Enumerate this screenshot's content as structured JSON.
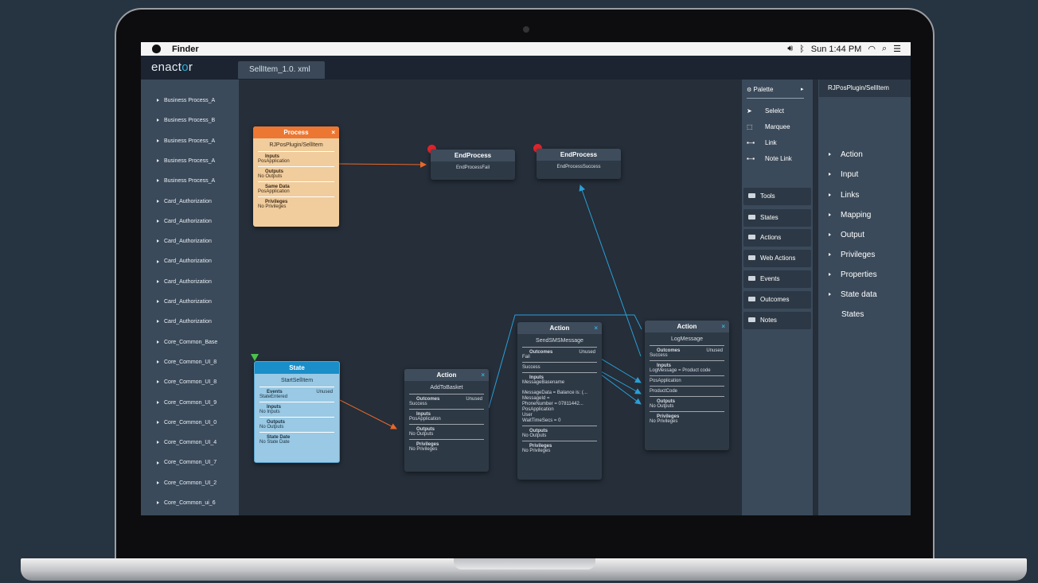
{
  "menubar": {
    "app": "Finder",
    "status": "Sun 1:44 PM"
  },
  "app": {
    "logo_pre": "enact",
    "logo_o": "o",
    "logo_post": "r",
    "tab": "SellItem_1.0. xml"
  },
  "sidebar": {
    "items": [
      "Business Process_A",
      "Business Process_B",
      "Business Process_A",
      "Business Process_A",
      "Business Process_A",
      "Card_Authorization",
      "Card_Authorization",
      "Card_Authorization",
      "Card_Authorization",
      "Card_Authorization",
      "Card_Authorization",
      "Card_Authorization",
      "Core_Common_Base",
      "Core_Common_UI_8",
      "Core_Common_UI_8",
      "Core_Common_UI_9",
      "Core_Common_UI_0",
      "Core_Common_UI_4",
      "Core_Common_UI_7",
      "Core_Common_UI_2",
      "Core_Common_ui_6"
    ]
  },
  "nodes": {
    "process": {
      "header": "Process",
      "close": "×",
      "name": "RJPosPlugin/SellItem",
      "inputs_label": "Inputs",
      "inputs_value": "PosApplication",
      "outputs_label": "Outputs",
      "outputs_value": "No Outputs",
      "same_label": "Same Data",
      "same_value": "PosApplication",
      "priv_label": "Privileges",
      "priv_value": "No Privileges"
    },
    "end_fail": {
      "header": "EndProcess",
      "name": "EndProcessFail"
    },
    "end_success": {
      "header": "EndProcess",
      "name": "EndProcessSuccess"
    },
    "state": {
      "header": "State",
      "name": "StartSellItem",
      "events_label": "Events",
      "events_unused": "Unused",
      "events_value": "StateEntered",
      "inputs_label": "Inputs",
      "inputs_value": "No Inputs",
      "outputs_label": "Outputs",
      "outputs_value": "No Outputs",
      "sdata_label": "State Date",
      "sdata_value": "No State Date"
    },
    "add": {
      "header": "Action",
      "close": "×",
      "name": "AddToBasket",
      "outcomes_label": "Outcomes",
      "outcomes_unused": "Unused",
      "outcomes_value": "Success",
      "inputs_label": "Inputs",
      "inputs_value": "PosApplication",
      "outputs_label": "Outputs",
      "outputs_value": "No Outputs",
      "priv_label": "Privileges",
      "priv_value": "No Privileges"
    },
    "sms": {
      "header": "Action",
      "close": "×",
      "name": "SendSMSMessage",
      "outcomes_label": "Outcomes",
      "outcomes_unused": "Unused",
      "outcomes_value": "Fail",
      "success_value": "Success",
      "inputs_label": "Inputs",
      "inputs_value1": "MessageBasename",
      "inputs_lines": [
        "MessageData = Balance is: (...",
        "MessageId =",
        "PhoneNumber = 07811442...",
        "PosApplication",
        "User",
        "WaitTimeSecs = 0"
      ],
      "outputs_label": "Outputs",
      "outputs_value": "No Outputs",
      "priv_label": "Privileges",
      "priv_value": "No Privileges"
    },
    "log": {
      "header": "Action",
      "close": "×",
      "name": "LogMessage",
      "outcomes_label": "Outcomes",
      "outcomes_unused": "Unused",
      "outcomes_value": "Success",
      "inputs_label": "Inputs",
      "inputs_value": "LogMessage = Product code",
      "pos_value": "PosApplication",
      "product_value": "ProductCode",
      "outputs_label": "Outputs",
      "outputs_value": "No Outputs",
      "priv_label": "Privileges",
      "priv_value": "No Privileges"
    }
  },
  "palette": {
    "title": "Palette",
    "tools": [
      "Selelct",
      "Marquee",
      "Link",
      "Note Link"
    ],
    "tool_icons": [
      "cursor-icon",
      "marquee-icon",
      "link-icon",
      "note-link-icon"
    ],
    "buttons": [
      "Tools",
      "States",
      "Actions",
      "Web Actions",
      "Events",
      "Outcomes",
      "Notes"
    ]
  },
  "properties": {
    "title": "RJPosPlugin/SellItem",
    "items": [
      "Action",
      "Input",
      "Links",
      "Mapping",
      "Output",
      "Privileges",
      "Properties",
      "State data",
      "States"
    ]
  },
  "colors": {
    "accent": "#2fb0e0",
    "process": "#ec7732",
    "state": "#1a8ec8",
    "wire_orange": "#e8682a",
    "wire_blue": "#2a9fd6",
    "end_dot": "#e0242c"
  }
}
